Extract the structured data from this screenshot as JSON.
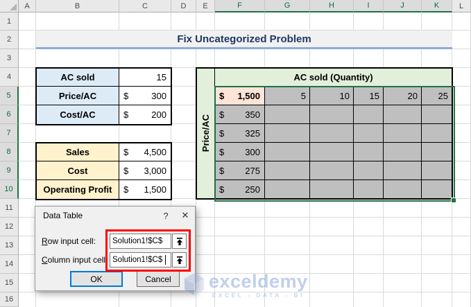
{
  "title": "Fix Uncategorized Problem",
  "sheet": {
    "column_headers": [
      "A",
      "B",
      "C",
      "D",
      "E",
      "F",
      "G",
      "H",
      "I",
      "J",
      "K",
      "L"
    ],
    "row_headers": [
      "1",
      "2",
      "3",
      "4",
      "5",
      "6",
      "7",
      "8",
      "9",
      "10",
      "11",
      "12",
      "13",
      "14",
      "15",
      "16"
    ],
    "selected_columns": [
      "F",
      "G",
      "H",
      "I",
      "J",
      "K"
    ],
    "selected_rows": [
      "5",
      "6",
      "7",
      "8",
      "9",
      "10"
    ]
  },
  "input_table": {
    "rows": [
      {
        "label": "AC sold",
        "currency": "",
        "value": "15"
      },
      {
        "label": "Price/AC",
        "currency": "$",
        "value": "300"
      },
      {
        "label": "Cost/AC",
        "currency": "$",
        "value": "200"
      }
    ]
  },
  "summary_table": {
    "rows": [
      {
        "label": "Sales",
        "currency": "$",
        "value": "4,500"
      },
      {
        "label": "Cost",
        "currency": "$",
        "value": "3,000"
      },
      {
        "label": "Operating Profit",
        "currency": "$",
        "value": "1,500"
      }
    ]
  },
  "data_table": {
    "column_header": "AC sold (Quantity)",
    "row_header": "Price/AC",
    "formula_cell": {
      "currency": "$",
      "value": "1,500"
    },
    "quantity_values": [
      "5",
      "10",
      "15",
      "20",
      "25"
    ],
    "price_currency": "$",
    "price_values": [
      "350",
      "325",
      "300",
      "275",
      "250"
    ]
  },
  "dialog": {
    "title": "Data Table",
    "help_icon": "?",
    "close_icon": "✕",
    "row_input": {
      "accesskey": "R",
      "label_rest": "ow input cell:",
      "value": "Solution1!$C$"
    },
    "column_input": {
      "accesskey": "C",
      "label_rest": "olumn input cell:",
      "value": "Solution1!$C$"
    },
    "ok_label": "OK",
    "cancel_label": "Cancel"
  },
  "watermark": {
    "brand": "exceldemy",
    "tagline": "EXCEL - DATA - BI"
  },
  "colors": {
    "selection_green": "#1E7145",
    "title_text": "#1F3864",
    "title_underline": "#8FAADC",
    "input_header_fill": "#DDEBF7",
    "summary_header_fill": "#FFF2CC",
    "data_table_green_fill": "#E2EFDA",
    "data_region_fill": "#BFBFBF",
    "formula_cell_fill": "#FCE4D6",
    "annotation_red": "#FF0000",
    "ok_button_border": "#0078D7",
    "watermark_blue": "#6E8FD0"
  }
}
